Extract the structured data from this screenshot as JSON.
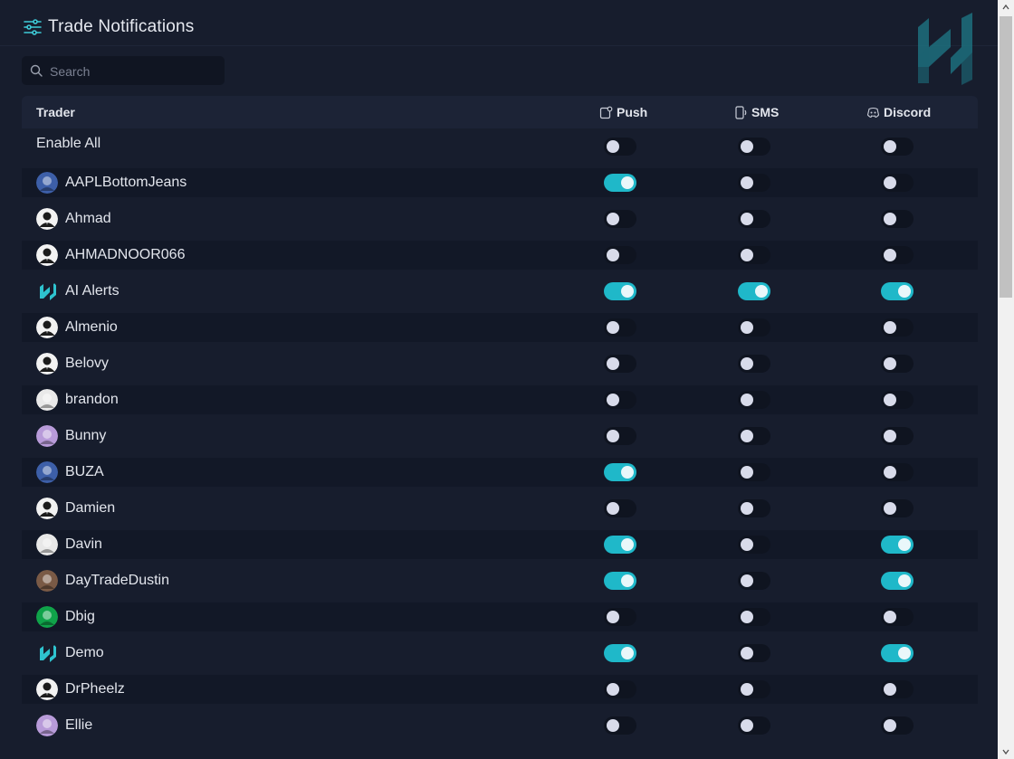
{
  "header": {
    "title": "Trade Notifications"
  },
  "search": {
    "placeholder": "Search"
  },
  "columns": {
    "trader": "Trader",
    "push": "Push",
    "sms": "SMS",
    "discord": "Discord"
  },
  "enable_all": {
    "label": "Enable All",
    "push": false,
    "sms": false,
    "discord": false
  },
  "traders": [
    {
      "name": "AAPLBottomJeans",
      "avatar": "photo-avatar",
      "push": true,
      "sms": false,
      "discord": false
    },
    {
      "name": "Ahmad",
      "avatar": "default-avatar",
      "push": false,
      "sms": false,
      "discord": false
    },
    {
      "name": "AHMADNOOR066",
      "avatar": "default-avatar",
      "push": false,
      "sms": false,
      "discord": false
    },
    {
      "name": "AI Alerts",
      "avatar": "brand-avatar",
      "push": true,
      "sms": true,
      "discord": true
    },
    {
      "name": "Almenio",
      "avatar": "default-avatar",
      "push": false,
      "sms": false,
      "discord": false
    },
    {
      "name": "Belovy",
      "avatar": "default-avatar",
      "push": false,
      "sms": false,
      "discord": false
    },
    {
      "name": "brandon",
      "avatar": "photo-avatar",
      "push": false,
      "sms": false,
      "discord": false
    },
    {
      "name": "Bunny",
      "avatar": "photo-avatar",
      "push": false,
      "sms": false,
      "discord": false
    },
    {
      "name": "BUZA",
      "avatar": "photo-avatar",
      "push": true,
      "sms": false,
      "discord": false
    },
    {
      "name": "Damien",
      "avatar": "default-avatar",
      "push": false,
      "sms": false,
      "discord": false
    },
    {
      "name": "Davin",
      "avatar": "photo-avatar",
      "push": true,
      "sms": false,
      "discord": true
    },
    {
      "name": "DayTradeDustin",
      "avatar": "photo-avatar",
      "push": true,
      "sms": false,
      "discord": true
    },
    {
      "name": "Dbig",
      "avatar": "photo-avatar",
      "push": false,
      "sms": false,
      "discord": false
    },
    {
      "name": "Demo",
      "avatar": "brand-avatar",
      "push": true,
      "sms": false,
      "discord": true
    },
    {
      "name": "DrPheelz",
      "avatar": "default-avatar",
      "push": false,
      "sms": false,
      "discord": false
    },
    {
      "name": "Ellie",
      "avatar": "photo-avatar",
      "push": false,
      "sms": false,
      "discord": false
    }
  ],
  "colors": {
    "accent": "#1fb8c9",
    "background": "#171d2d",
    "row_alt": "#121827"
  }
}
